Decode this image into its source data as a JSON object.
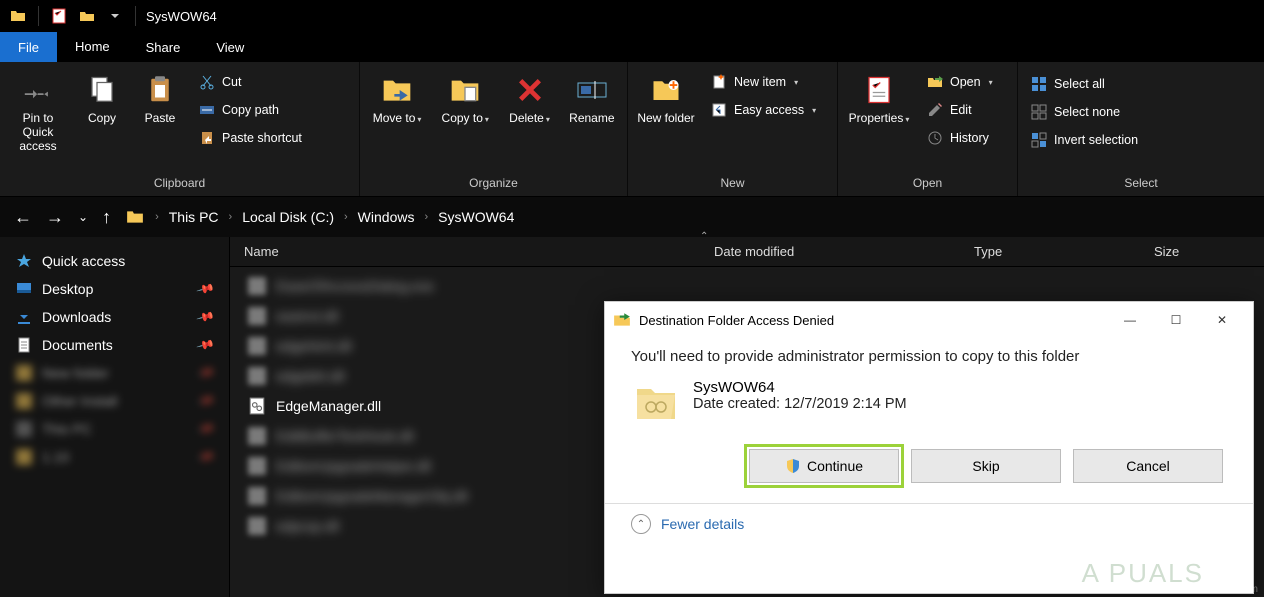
{
  "window": {
    "title": "SysWOW64"
  },
  "tabs": {
    "file": "File",
    "home": "Home",
    "share": "Share",
    "view": "View"
  },
  "ribbon": {
    "clipboard": {
      "label": "Clipboard",
      "pin": "Pin to Quick access",
      "copy": "Copy",
      "paste": "Paste",
      "cut": "Cut",
      "copy_path": "Copy path",
      "paste_shortcut": "Paste shortcut"
    },
    "organize": {
      "label": "Organize",
      "move_to": "Move to",
      "copy_to": "Copy to",
      "delete": "Delete",
      "rename": "Rename"
    },
    "new": {
      "label": "New",
      "new_folder": "New folder",
      "new_item": "New item",
      "easy_access": "Easy access"
    },
    "open": {
      "label": "Open",
      "properties": "Properties",
      "open": "Open",
      "edit": "Edit",
      "history": "History"
    },
    "select": {
      "label": "Select",
      "select_all": "Select all",
      "select_none": "Select none",
      "invert": "Invert selection"
    }
  },
  "breadcrumb": {
    "items": [
      "This PC",
      "Local Disk (C:)",
      "Windows",
      "SysWOW64"
    ]
  },
  "columns": {
    "name": "Name",
    "date": "Date modified",
    "type": "Type",
    "size": "Size"
  },
  "sidebar": {
    "quick": "Quick access",
    "desktop": "Desktop",
    "downloads": "Downloads",
    "documents": "Documents"
  },
  "files": {
    "visible": "EdgeManager.dll"
  },
  "dialog": {
    "title": "Destination Folder Access Denied",
    "message": "You'll need to provide administrator permission to copy to this folder",
    "folder_name": "SysWOW64",
    "date_label": "Date created: 12/7/2019 2:14 PM",
    "continue": "Continue",
    "skip": "Skip",
    "cancel": "Cancel",
    "fewer_details": "Fewer details"
  },
  "watermark": "A  PUALS",
  "attribution": "wsxdn.com"
}
